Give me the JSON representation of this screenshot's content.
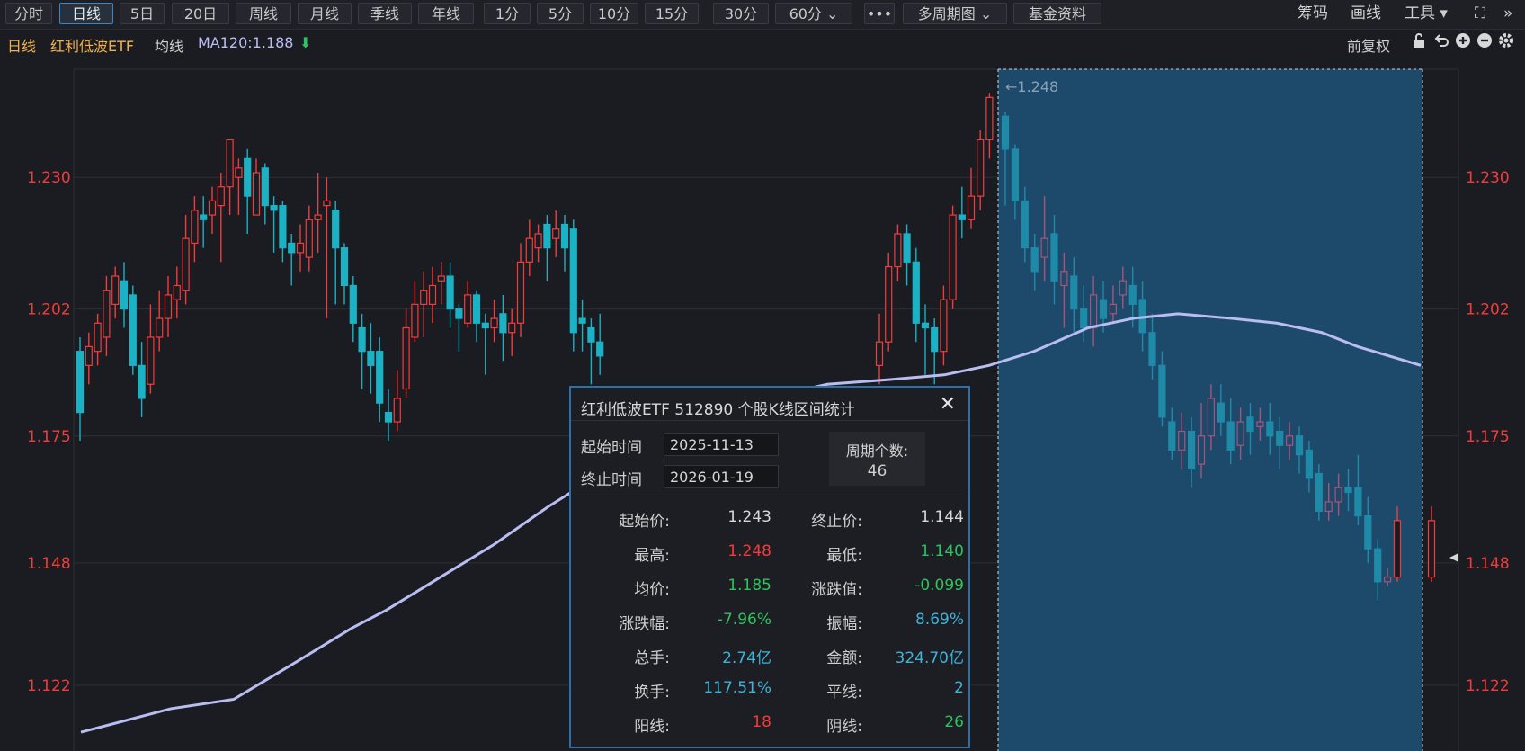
{
  "toolbar": {
    "buttons": [
      "分时",
      "日线",
      "5日",
      "20日",
      "周线",
      "月线",
      "季线",
      "年线",
      "1分",
      "5分",
      "10分",
      "15分",
      "30分",
      "60分 ⌄",
      "•••",
      "多周期图 ⌄",
      "基金资料"
    ],
    "active_index": 1,
    "right": [
      "筹码",
      "画线",
      "工具 ▾"
    ]
  },
  "info": {
    "period": "日线",
    "name": "红利低波ETF",
    "ma_label": "均线",
    "ma_value": "MA120:1.188",
    "ma_arrow": "⬇",
    "fq": "前复权"
  },
  "colors": {
    "up": "#f23c3c",
    "down": "#1ab2c4",
    "ma": "#b9bdf2",
    "select": "#1d4a6b"
  },
  "chart_data": {
    "type": "candlestick",
    "y_ticks": [
      "1.230",
      "1.202",
      "1.175",
      "1.148",
      "1.122"
    ],
    "ylim": [
      1.108,
      1.253
    ],
    "max_label": "←1.248",
    "candles": [
      [
        1.193,
        1.18,
        1.196,
        1.174
      ],
      [
        1.19,
        1.194,
        1.197,
        1.186
      ],
      [
        1.193,
        1.199,
        1.201,
        1.19
      ],
      [
        1.196,
        1.206,
        1.209,
        1.192
      ],
      [
        1.203,
        1.209,
        1.211,
        1.2
      ],
      [
        1.208,
        1.202,
        1.212,
        1.198
      ],
      [
        1.205,
        1.19,
        1.207,
        1.188
      ],
      [
        1.19,
        1.183,
        1.195,
        1.179
      ],
      [
        1.186,
        1.196,
        1.203,
        1.184
      ],
      [
        1.196,
        1.2,
        1.206,
        1.193
      ],
      [
        1.2,
        1.205,
        1.209,
        1.196
      ],
      [
        1.204,
        1.207,
        1.211,
        1.2
      ],
      [
        1.206,
        1.217,
        1.222,
        1.203
      ],
      [
        1.216,
        1.223,
        1.226,
        1.212
      ],
      [
        1.222,
        1.221,
        1.226,
        1.215
      ],
      [
        1.222,
        1.225,
        1.228,
        1.218
      ],
      [
        1.224,
        1.228,
        1.231,
        1.212
      ],
      [
        1.228,
        1.238,
        1.236,
        1.222
      ],
      [
        1.23,
        1.232,
        1.234,
        1.222
      ],
      [
        1.234,
        1.226,
        1.236,
        1.218
      ],
      [
        1.222,
        1.231,
        1.234,
        1.222
      ],
      [
        1.232,
        1.224,
        1.233,
        1.22
      ],
      [
        1.224,
        1.223,
        1.226,
        1.214
      ],
      [
        1.224,
        1.215,
        1.225,
        1.212
      ],
      [
        1.216,
        1.214,
        1.218,
        1.207
      ],
      [
        1.214,
        1.216,
        1.22,
        1.21
      ],
      [
        1.213,
        1.221,
        1.224,
        1.21
      ],
      [
        1.221,
        1.222,
        1.231,
        1.214
      ],
      [
        1.224,
        1.225,
        1.23,
        1.2
      ],
      [
        1.223,
        1.215,
        1.225,
        1.203
      ],
      [
        1.215,
        1.207,
        1.216,
        1.203
      ],
      [
        1.207,
        1.199,
        1.209,
        1.195
      ],
      [
        1.198,
        1.193,
        1.201,
        1.185
      ],
      [
        1.193,
        1.19,
        1.199,
        1.184
      ],
      [
        1.193,
        1.182,
        1.196,
        1.178
      ],
      [
        1.18,
        1.178,
        1.185,
        1.174
      ],
      [
        1.178,
        1.183,
        1.189,
        1.176
      ],
      [
        1.185,
        1.198,
        1.202,
        1.183
      ],
      [
        1.196,
        1.203,
        1.208,
        1.195
      ],
      [
        1.203,
        1.206,
        1.21,
        1.196
      ],
      [
        1.203,
        1.207,
        1.211,
        1.199
      ],
      [
        1.208,
        1.209,
        1.212,
        1.203
      ],
      [
        1.209,
        1.202,
        1.212,
        1.198
      ],
      [
        1.202,
        1.2,
        1.203,
        1.193
      ],
      [
        1.199,
        1.205,
        1.208,
        1.198
      ],
      [
        1.205,
        1.199,
        1.206,
        1.195
      ],
      [
        1.199,
        1.198,
        1.201,
        1.188
      ],
      [
        1.198,
        1.2,
        1.204,
        1.195
      ],
      [
        1.201,
        1.197,
        1.205,
        1.191
      ],
      [
        1.197,
        1.199,
        1.202,
        1.192
      ],
      [
        1.199,
        1.212,
        1.216,
        1.196
      ],
      [
        1.212,
        1.217,
        1.221,
        1.209
      ],
      [
        1.215,
        1.218,
        1.22,
        1.212
      ],
      [
        1.22,
        1.215,
        1.222,
        1.208
      ],
      [
        1.217,
        1.219,
        1.223,
        1.213
      ],
      [
        1.22,
        1.215,
        1.222,
        1.21
      ],
      [
        1.219,
        1.197,
        1.221,
        1.193
      ],
      [
        1.2,
        1.199,
        1.204,
        1.193
      ],
      [
        1.198,
        1.195,
        1.2,
        1.186
      ],
      [
        1.195,
        1.192,
        1.201,
        1.188
      ]
    ],
    "ma_points": [
      [
        0,
        1.112
      ],
      [
        100,
        1.117
      ],
      [
        170,
        1.119
      ],
      [
        240,
        1.127
      ],
      [
        300,
        1.134
      ],
      [
        340,
        1.138
      ],
      [
        400,
        1.145
      ],
      [
        460,
        1.152
      ],
      [
        520,
        1.16
      ],
      [
        570,
        1.166
      ],
      [
        620,
        1.171
      ],
      [
        680,
        1.178
      ],
      [
        760,
        1.183
      ],
      [
        830,
        1.186
      ],
      [
        900,
        1.187
      ],
      [
        960,
        1.188
      ],
      [
        1010,
        1.19
      ],
      [
        1060,
        1.193
      ],
      [
        1120,
        1.198
      ],
      [
        1170,
        1.2
      ],
      [
        1220,
        1.201
      ],
      [
        1280,
        1.2
      ],
      [
        1330,
        1.199
      ],
      [
        1380,
        1.197
      ],
      [
        1420,
        1.194
      ],
      [
        1490,
        1.19
      ]
    ],
    "right_candles": [
      [
        1.243,
        1.236,
        1.244,
        1.224
      ],
      [
        1.236,
        1.225,
        1.237,
        1.221
      ],
      [
        1.225,
        1.215,
        1.228,
        1.212
      ],
      [
        1.215,
        1.21,
        1.218,
        1.206
      ],
      [
        1.213,
        1.217,
        1.226,
        1.208
      ],
      [
        1.218,
        1.208,
        1.222,
        1.203
      ],
      [
        1.207,
        1.21,
        1.214,
        1.198
      ],
      [
        1.209,
        1.202,
        1.213,
        1.197
      ],
      [
        1.202,
        1.198,
        1.207,
        1.195
      ],
      [
        1.198,
        1.205,
        1.209,
        1.194
      ],
      [
        1.204,
        1.2,
        1.208,
        1.197
      ],
      [
        1.201,
        1.203,
        1.207,
        1.199
      ],
      [
        1.205,
        1.208,
        1.211,
        1.202
      ],
      [
        1.207,
        1.203,
        1.211,
        1.198
      ],
      [
        1.204,
        1.197,
        1.208,
        1.193
      ],
      [
        1.197,
        1.19,
        1.201,
        1.187
      ],
      [
        1.19,
        1.179,
        1.193,
        1.177
      ],
      [
        1.178,
        1.172,
        1.181,
        1.17
      ],
      [
        1.172,
        1.176,
        1.18,
        1.168
      ],
      [
        1.176,
        1.168,
        1.179,
        1.164
      ],
      [
        1.169,
        1.175,
        1.182,
        1.166
      ],
      [
        1.175,
        1.183,
        1.186,
        1.172
      ],
      [
        1.182,
        1.178,
        1.186,
        1.175
      ],
      [
        1.178,
        1.172,
        1.183,
        1.169
      ],
      [
        1.173,
        1.178,
        1.181,
        1.17
      ],
      [
        1.179,
        1.176,
        1.182,
        1.171
      ],
      [
        1.177,
        1.178,
        1.181,
        1.174
      ],
      [
        1.178,
        1.175,
        1.182,
        1.171
      ],
      [
        1.176,
        1.173,
        1.179,
        1.168
      ],
      [
        1.173,
        1.175,
        1.178,
        1.17
      ],
      [
        1.175,
        1.171,
        1.177,
        1.167
      ],
      [
        1.172,
        1.166,
        1.174,
        1.163
      ],
      [
        1.167,
        1.159,
        1.169,
        1.157
      ],
      [
        1.159,
        1.161,
        1.165,
        1.157
      ],
      [
        1.161,
        1.164,
        1.167,
        1.158
      ],
      [
        1.164,
        1.163,
        1.168,
        1.159
      ],
      [
        1.164,
        1.158,
        1.171,
        1.156
      ],
      [
        1.158,
        1.151,
        1.162,
        1.148
      ],
      [
        1.151,
        1.144,
        1.153,
        1.14
      ],
      [
        1.144,
        1.145,
        1.147,
        1.143
      ],
      [
        1.145,
        1.157,
        1.16,
        1.144
      ]
    ]
  },
  "popup": {
    "title": "红利低波ETF  512890  个股K线区间统计",
    "close": "✕",
    "start_label": "起始时间",
    "start_value": "2025-11-13",
    "end_label": "终止时间",
    "end_value": "2026-01-19",
    "count_label": "周期个数:",
    "count_value": "46",
    "rows": [
      {
        "k1": "起始价:",
        "v1": "1.243",
        "c1": "white",
        "k2": "终止价:",
        "v2": "1.144",
        "c2": "white"
      },
      {
        "k1": "最高:",
        "v1": "1.248",
        "c1": "up",
        "k2": "最低:",
        "v2": "1.140",
        "c2": "down"
      },
      {
        "k1": "均价:",
        "v1": "1.185",
        "c1": "down",
        "k2": "涨跌值:",
        "v2": "-0.099",
        "c2": "down"
      },
      {
        "k1": "涨跌幅:",
        "v1": "-7.96%",
        "c1": "down",
        "k2": "振幅:",
        "v2": "8.69%",
        "c2": "cyan"
      },
      {
        "k1": "总手:",
        "v1": "2.74亿",
        "c1": "cyan",
        "k2": "金额:",
        "v2": "324.70亿",
        "c2": "cyan"
      },
      {
        "k1": "换手:",
        "v1": "117.51%",
        "c1": "cyan",
        "k2": "平线:",
        "v2": "2",
        "c2": "cyan"
      },
      {
        "k1": "阳线:",
        "v1": "18",
        "c1": "up",
        "k2": "阴线:",
        "v2": "26",
        "c2": "down"
      }
    ]
  }
}
